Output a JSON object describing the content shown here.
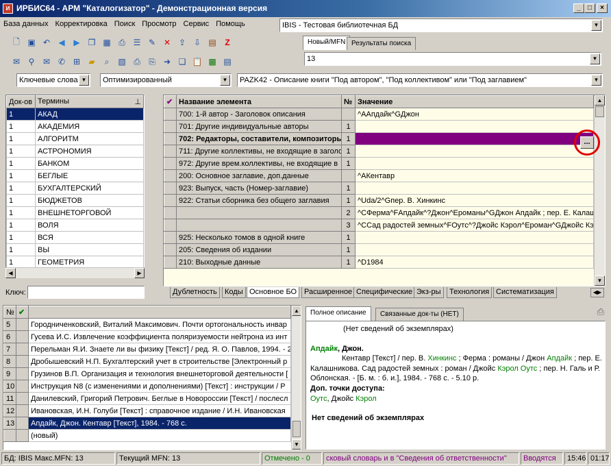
{
  "window": {
    "title": "ИРБИС64 - АРМ \"Каталогизатор\" - Демонстрационная версия",
    "min": "_",
    "max": "□",
    "close": "×"
  },
  "menu": [
    "База данных",
    "Корректировка",
    "Поиск",
    "Просмотр",
    "Сервис",
    "Помощь"
  ],
  "db_combo": "IBIS - Тестовая библиотечная БД",
  "record_tabs": [
    "Новый/MFN",
    "Результаты поиска"
  ],
  "mfn_combo": "13",
  "filters": {
    "dictionary": "Ключевые слова",
    "mode": "Оптимизированный",
    "worksheet": "PAZK42 - Описание книги \"Под автором\", \"Под коллективом\" или \"Под заглавием\""
  },
  "terms": {
    "headers": [
      "Док-ов",
      "Термины"
    ],
    "pin_icon": "pin-icon",
    "rows": [
      {
        "count": "1",
        "term": "АКАД"
      },
      {
        "count": "1",
        "term": "АКАДЕМИЯ"
      },
      {
        "count": "1",
        "term": "АЛГОРИТМ"
      },
      {
        "count": "1",
        "term": "АСТРОНОМИЯ"
      },
      {
        "count": "1",
        "term": "БАНКОМ"
      },
      {
        "count": "1",
        "term": "БЕГЛЫЕ"
      },
      {
        "count": "1",
        "term": "БУХГАЛТЕРСКИЙ"
      },
      {
        "count": "1",
        "term": "БЮДЖЕТОВ"
      },
      {
        "count": "1",
        "term": "ВНЕШНЕТОРГОВОЙ"
      },
      {
        "count": "1",
        "term": "ВОЛЯ"
      },
      {
        "count": "1",
        "term": "ВСЯ"
      },
      {
        "count": "1",
        "term": "ВЫ"
      },
      {
        "count": "1",
        "term": "ГЕОМЕТРИЯ"
      }
    ],
    "key_label": "Ключ:"
  },
  "fields": {
    "headers": [
      "Название элемента",
      "№",
      "Значение"
    ],
    "rows": [
      {
        "name": "700: 1-й автор - Заголовок описания",
        "num": "",
        "value": "^AАпдайк^GДжон"
      },
      {
        "name": "701: Другие индивидуальные авторы",
        "num": "1",
        "value": ""
      },
      {
        "name": "702: Редакторы, составители, композиторы",
        "num": "1",
        "value": "",
        "bold": true,
        "selected": true
      },
      {
        "name": "711: Другие коллективы, не входящие в заголов",
        "num": "1",
        "value": ""
      },
      {
        "name": "972: Другие врем.коллективы, не входящие в",
        "num": "1",
        "value": ""
      },
      {
        "name": "200: Основное заглавие, доп.данные",
        "num": "",
        "value": "^AКентавр"
      },
      {
        "name": "923: Выпуск, часть (Номер-заглавие)",
        "num": "1",
        "value": ""
      },
      {
        "name": "922: Статьи сборника без общего заглавия",
        "num": "1",
        "value": "^Uda/2^Gпер. В. Хинкинс"
      },
      {
        "name": "",
        "num": "2",
        "value": "^CФерма^FАпдайк^?Джон^Eроманы^GДжон Апдайк ; пер. Е. Калашн"
      },
      {
        "name": "",
        "num": "3",
        "value": "^CСад радостей земных^FОутс^?Джойс Кэрол^Eроман^GДжойс Кэ"
      },
      {
        "name": "925: Несколько томов в одной книге",
        "num": "1",
        "value": ""
      },
      {
        "name": "205: Сведения об издании",
        "num": "1",
        "value": ""
      },
      {
        "name": "210: Выходные данные",
        "num": "1",
        "value": "^D1984"
      }
    ],
    "ellipsis": "...",
    "bottom_tabs": [
      "Дублетность",
      "Коды",
      "Основное БО",
      "Расширенное",
      "Специфические",
      "Экз-ры",
      "Технология",
      "Систематизация"
    ]
  },
  "records": {
    "headers": [
      "№"
    ],
    "rows": [
      {
        "n": "5",
        "text": "Городниченковский, Виталий Максимович. Почти ортогональность инвар"
      },
      {
        "n": "6",
        "text": "Гусева И.С. Извлечение коэффициента поляризуемости нейтрона из инт"
      },
      {
        "n": "7",
        "text": "Перельман Я.И. Знаете ли вы физику [Текст] / ред. Я. О. Павлов, 1994. - 2"
      },
      {
        "n": "8",
        "text": "Дробышевский Н.П. Бухгалтерский учет в строительстве [Электронный р"
      },
      {
        "n": "9",
        "text": "Грузинов В.П. Организация и технология внешнеторговой деятельности ["
      },
      {
        "n": "10",
        "text": "Инструкция N8   (с изменениями и дополнениями) [Текст] : инструкции / Р"
      },
      {
        "n": "11",
        "text": "Данилевский, Григорий Петрович. Беглые в Новороссии [Текст] / послесл"
      },
      {
        "n": "12",
        "text": "Ивановская, И.Н. Голуби [Текст] : справочное издание / И.Н. Ивановская"
      },
      {
        "n": "13",
        "text": "Апдайк, Джон. Кентавр [Текст], 1984. - 768 с.",
        "selected": true
      },
      {
        "n": "",
        "text": "(новый)"
      }
    ]
  },
  "desc": {
    "tabs": [
      "Полное описание",
      "Связанные док-ты (НЕТ)"
    ],
    "no_copies_top": "(Нет сведений об экземплярах)",
    "author": "Апдайк",
    "author_rest": ", Джон.",
    "line1a": "Кентавр [Текст] / пер. В. ",
    "line1b": "Хинкинс",
    "line1c": " ; Ферма : романы / Джон ",
    "line1d": "Апдайк",
    "line1e": " ; пер. Е.",
    "line2a": "Калашникова. Сад радостей земных : роман / Джойс ",
    "line2b": "Кэрол Оутс",
    "line2c": " ; пер. Н. Галь и Р.",
    "line3": "Облонская. - [Б. м. : б. и.], 1984. - 768 с. - 5.10 р.",
    "access_label": "Доп. точки доступа:",
    "access1": "Оутс",
    "access2": ", Джойс ",
    "access3": "Кэрол",
    "no_copies": "Нет сведений об экземплярах"
  },
  "status": {
    "db": "БД: IBIS Макс.MFN: 13",
    "current": "Текущий MFN: 13",
    "marked": "Отмечено - 0",
    "hint": "сковый словарь и в \"Сведения об ответственности\"",
    "entering": "Вводятся",
    "time": "15:46",
    "time2": "01:17"
  },
  "colors": {
    "accent": "#0a246a",
    "selected_field": "#800080",
    "highlight": "#e00000",
    "link": "#008000"
  }
}
